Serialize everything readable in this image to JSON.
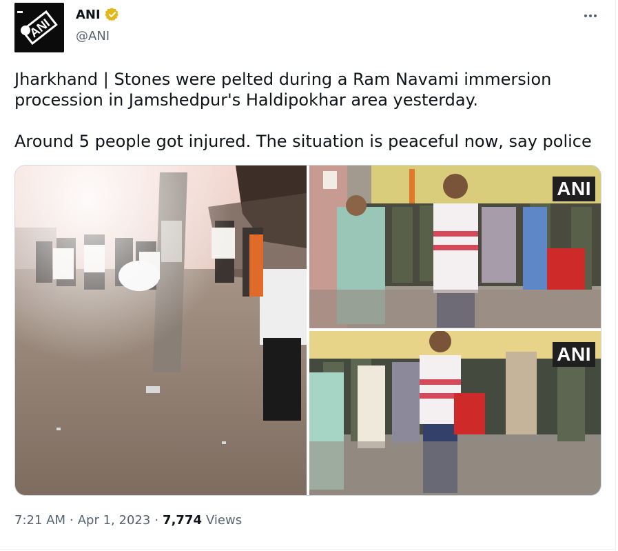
{
  "author": {
    "name": "ANI",
    "handle": "@ANI",
    "avatar_text": "ANI",
    "verified_color": "#e2b719"
  },
  "tweet": {
    "text": "Jharkhand | Stones were pelted during a Ram Navami immersion\nprocession in Jamshedpur's Haldipokhar area yesterday.\n\nAround 5 people got injured. The situation is peaceful now, say police",
    "time": "7:21 AM",
    "date": "Apr 1, 2023",
    "separator": "·",
    "views_count": "7,774",
    "views_label": "Views"
  },
  "media": {
    "watermark": "ANI",
    "photos": [
      {
        "icon": "street-crowd-photo"
      },
      {
        "icon": "crowd-police-photo"
      },
      {
        "icon": "crowd-police-photo"
      }
    ]
  },
  "colors": {
    "text": "#0f1419",
    "secondary": "#536471",
    "border": "#cfd9de"
  }
}
